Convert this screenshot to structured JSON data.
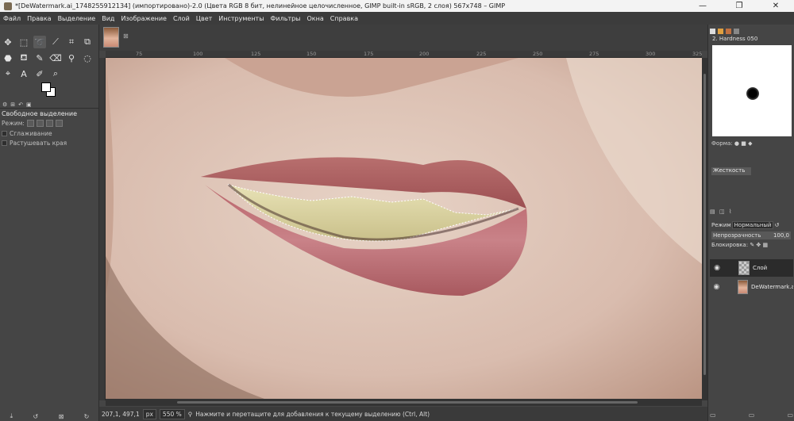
{
  "window": {
    "title": "*[DeWatermark.ai_1748255912134] (импортировано)-2.0 (Цвета RGB 8 бит, нелинейное целочисленное, GIMP built-in sRGB, 2 слоя) 567x748 – GIMP",
    "minimize": "—",
    "maximize": "❐",
    "close": "✕"
  },
  "menu": [
    "Файл",
    "Правка",
    "Выделение",
    "Вид",
    "Изображение",
    "Слой",
    "Цвет",
    "Инструменты",
    "Фильтры",
    "Окна",
    "Справка"
  ],
  "tool_options": {
    "title": "Свободное выделение",
    "mode_label": "Режим:",
    "antialias": "Сглаживание",
    "feather": "Растушевать края"
  },
  "ruler": {
    "ticks": [
      "75",
      "100",
      "125",
      "150",
      "175",
      "200",
      "225",
      "250",
      "275",
      "300",
      "325"
    ]
  },
  "status": {
    "coords": "207,1, 497,1",
    "unit": "px",
    "zoom": "550 %",
    "hint": "Нажмите и перетащите для добавления к текущему выделению (Ctrl, Alt)"
  },
  "brushes": {
    "name": "2. Hardness 050",
    "shape_label": "Форма:",
    "hardness_label": "Жесткость"
  },
  "layers": {
    "mode_label": "Режим",
    "mode_value": "Нормальный",
    "opacity_label": "Непрозрачность",
    "opacity_value": "100,0",
    "lock_label": "Блокировка:",
    "items": [
      {
        "name": "Слой"
      },
      {
        "name": "DeWatermark.ai"
      }
    ]
  },
  "colors": {
    "accent": "#5a5a5a",
    "background": "#454545"
  }
}
